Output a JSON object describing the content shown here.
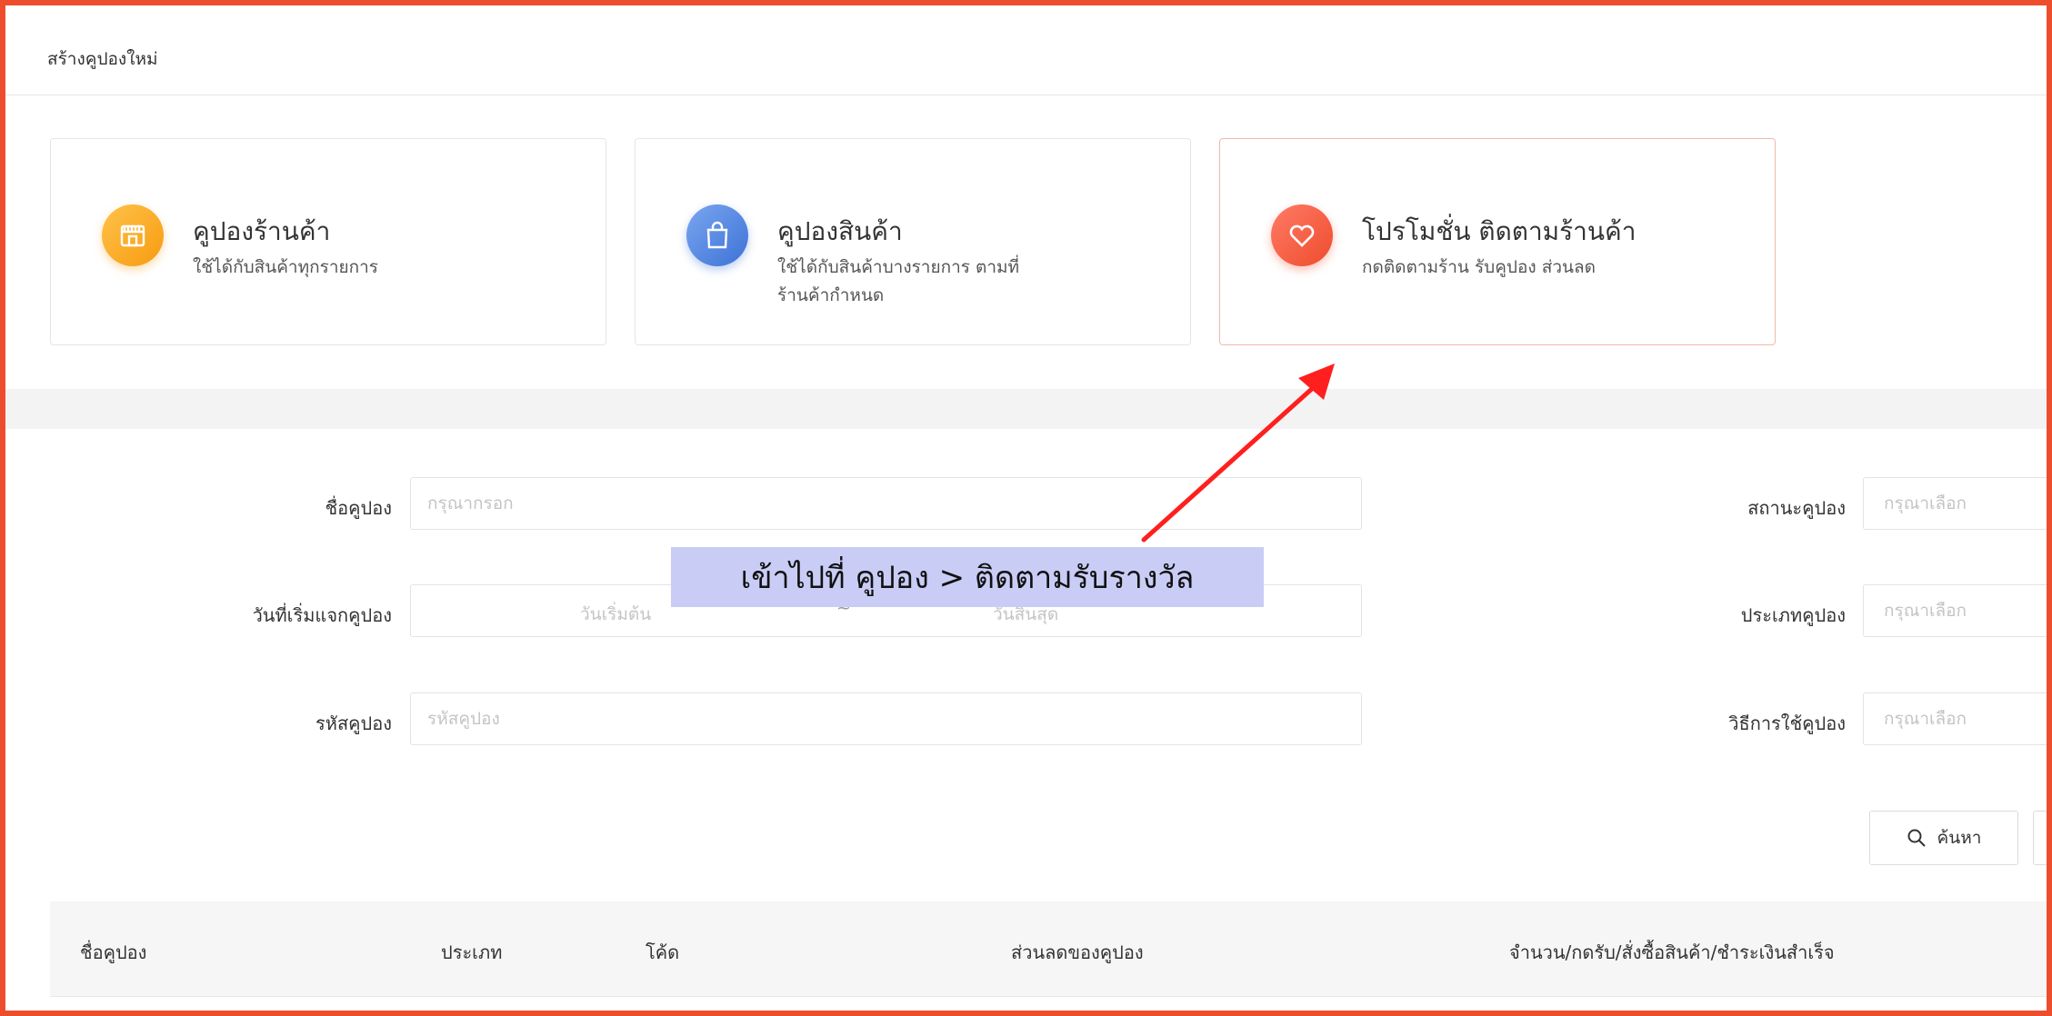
{
  "page": {
    "title": "สร้างคูปองใหม่"
  },
  "cards": [
    {
      "title": "คูปองร้านค้า",
      "desc": "ใช้ได้กับสินค้าทุกรายการ",
      "icon": "store-icon",
      "color": "#f7a21b"
    },
    {
      "title": "คูปองสินค้า",
      "desc": "ใช้ได้กับสินค้าบางรายการ ตามที่ร้านค้ากำหนด",
      "icon": "shopping-bag-icon",
      "color": "#4a7fe0"
    },
    {
      "title": "โปรโมชั่น ติดตามร้านค้า",
      "desc": "กดติดตามร้าน รับคูปอง ส่วนลด",
      "icon": "heart-icon",
      "color": "#ee4d2d"
    }
  ],
  "form": {
    "name": {
      "label": "ชื่อคูปอง",
      "placeholder": "กรุณากรอก"
    },
    "date": {
      "label": "วันที่เริ่มแจกคูปอง",
      "start": "วันเริ่มต้น",
      "sep": "~",
      "end": "วันสิ้นสุด"
    },
    "code": {
      "label": "รหัสคูปอง",
      "placeholder": "รหัสคูปอง"
    },
    "status": {
      "label": "สถานะคูปอง",
      "placeholder": "กรุณาเลือก"
    },
    "type": {
      "label": "ประเภทคูปอง",
      "placeholder": "กรุณาเลือก"
    },
    "usage": {
      "label": "วิธีการใช้คูปอง",
      "placeholder": "กรุณาเลือก"
    },
    "search_label": "ค้นหา"
  },
  "table": {
    "columns": [
      "ชื่อคูปอง",
      "ประเภท",
      "โค้ด",
      "ส่วนลดของคูปอง",
      "จำนวน/กดรับ/สั่งซื้อสินค้า/ชำระเงินสำเร็จ"
    ]
  },
  "annotation": {
    "text": "เข้าไปที่ คูปอง > ติดตามรับรางวัล",
    "color": "#c9cdf6",
    "arrow_color": "#ff1f1f"
  },
  "colors": {
    "accent": "#ee4d2d"
  }
}
